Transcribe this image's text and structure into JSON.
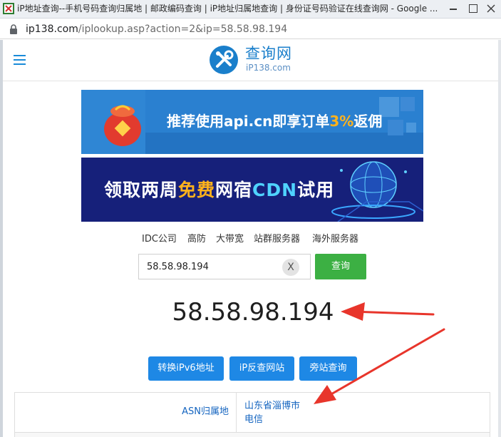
{
  "window": {
    "title": "iP地址查询--手机号码查询归属地 | 邮政编码查询 | iP地址归属地查询 | 身份证号码验证在线查询网 - Google ..."
  },
  "address_bar": {
    "host": "ip138.com",
    "path": "/iplookup.asp?action=2&ip=58.58.98.194"
  },
  "logo": {
    "cn": "查询网",
    "en": "iP138.com"
  },
  "banners": [
    {
      "pre": "推荐使用api.cn即享订单",
      "highlight": "3%",
      "post": "返佣"
    },
    {
      "pre": "领取两周",
      "highlight": "免费",
      "mid": "网宿",
      "highlight2": "CDN",
      "post": "试用"
    }
  ],
  "categories": [
    "IDC公司",
    "高防",
    "大带宽",
    "站群服务器",
    "海外服务器"
  ],
  "search": {
    "value": "58.58.98.194",
    "clear_label": "X",
    "button_label": "查询"
  },
  "result_ip": "58.58.98.194",
  "actions": [
    "转换iPv6地址",
    "iP反查网站",
    "旁站查询"
  ],
  "result_table": {
    "label": "ASN归属地",
    "value_line1": "山东省淄博市",
    "value_line2": "电信"
  },
  "colors": {
    "brand_blue": "#1a7fcb",
    "action_blue": "#1e88e5",
    "query_green": "#3cb043",
    "annotation_red": "#e8352b"
  }
}
